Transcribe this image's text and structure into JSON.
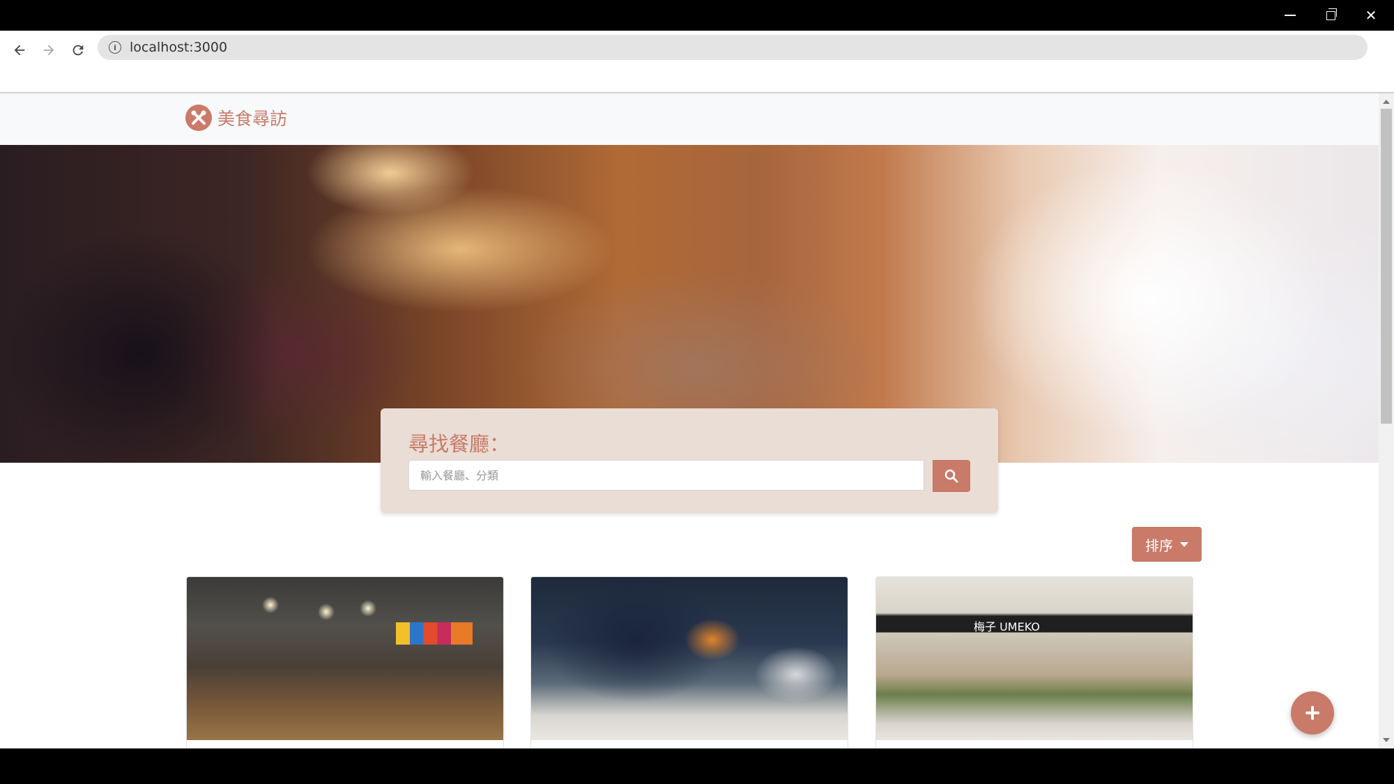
{
  "browser": {
    "url": "localhost:3000"
  },
  "navbar": {
    "brand_name": "美食尋訪"
  },
  "search": {
    "title": "尋找餐廳：",
    "placeholder": "輸入餐廳、分類",
    "value": ""
  },
  "sort": {
    "label": "排序"
  },
  "restaurants": [
    {
      "image": "restaurant-dining-room"
    },
    {
      "image": "chef-cooking-kitchen"
    },
    {
      "image": "umeko-storefront"
    }
  ],
  "colors": {
    "brand": "#c97a68",
    "search_card_bg": "#eaddd6",
    "navbar_bg": "#f8f9fa"
  },
  "icons": [
    "back-arrow-icon",
    "forward-arrow-icon",
    "reload-icon",
    "info-icon",
    "fork-spoon-logo-icon",
    "search-icon",
    "plus-icon",
    "caret-down-icon"
  ]
}
